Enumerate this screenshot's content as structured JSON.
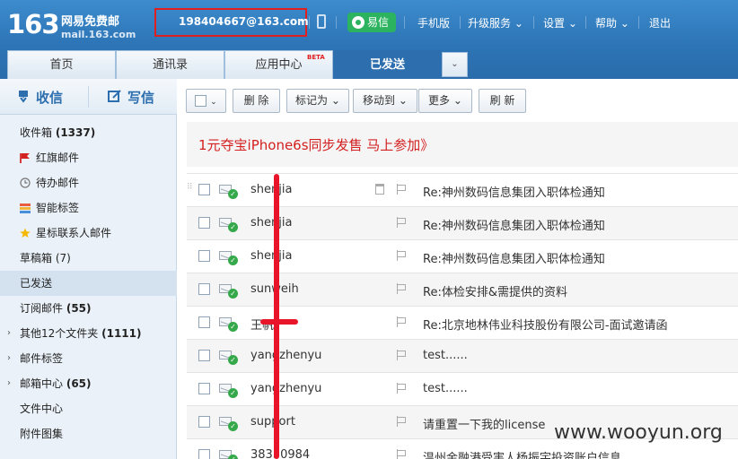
{
  "header": {
    "logo_number": "163",
    "logo_name": "网易免费邮",
    "logo_site": "mail.163.com",
    "account": "198404667@163.com",
    "yixin": "易信",
    "links": [
      "手机版",
      "升级服务",
      "设置",
      "帮助",
      "退出"
    ]
  },
  "tabs": [
    "首页",
    "通讯录",
    "应用中心",
    "已发送"
  ],
  "tab_beta": "BETA",
  "sidebar": {
    "receive": "收信",
    "write": "写信",
    "items": [
      {
        "label": "收件箱",
        "count": "(1337)",
        "icon": "inbox"
      },
      {
        "label": "红旗邮件",
        "icon": "red-flag-icon"
      },
      {
        "label": "待办邮件",
        "icon": "clock-icon"
      },
      {
        "label": "智能标签",
        "icon": "tag-stack-icon"
      },
      {
        "label": "星标联系人邮件",
        "icon": "star-icon"
      },
      {
        "label": "草稿箱",
        "count": "(7)"
      },
      {
        "label": "已发送"
      },
      {
        "label": "订阅邮件",
        "count": "(55)"
      },
      {
        "label": "其他12个文件夹",
        "count": "(1111)"
      },
      {
        "label": "邮件标签"
      },
      {
        "label": "邮箱中心",
        "count": "(65)"
      },
      {
        "label": "文件中心"
      },
      {
        "label": "附件图集"
      }
    ]
  },
  "toolbar": {
    "delete": "删 除",
    "mark_as": "标记为",
    "move_to": "移动到",
    "more": "更多",
    "refresh": "刷 新"
  },
  "banner": "1元夺宝iPhone6s同步发售 马上参加》",
  "mails": [
    {
      "recipient": "shenjia",
      "subject": "Re:神州数码信息集团入职体检通知"
    },
    {
      "recipient": "shenjia",
      "subject": "Re:神州数码信息集团入职体检通知"
    },
    {
      "recipient": "shenjia",
      "subject": "Re:神州数码信息集团入职体检通知"
    },
    {
      "recipient": "sunweih",
      "subject": "Re:体检安排&需提供的资料"
    },
    {
      "recipient": "王帆",
      "subject": "Re:北京地林伟业科技股份有限公司-面试邀请函"
    },
    {
      "recipient": "yangzhenyu",
      "subject": "test......"
    },
    {
      "recipient": "yangzhenyu",
      "subject": "test......"
    },
    {
      "recipient": "support",
      "subject": "请重置一下我的license"
    },
    {
      "recipient": "38330984",
      "subject": "温州金融港受害人杨振宇投资账户信息"
    }
  ],
  "watermark": "www.wooyun.org",
  "colors": {
    "header_blue": "#2d75b7",
    "banner_red": "#d32020",
    "annotation_red": "#e8152a",
    "yixin_green": "#2bb35f"
  }
}
